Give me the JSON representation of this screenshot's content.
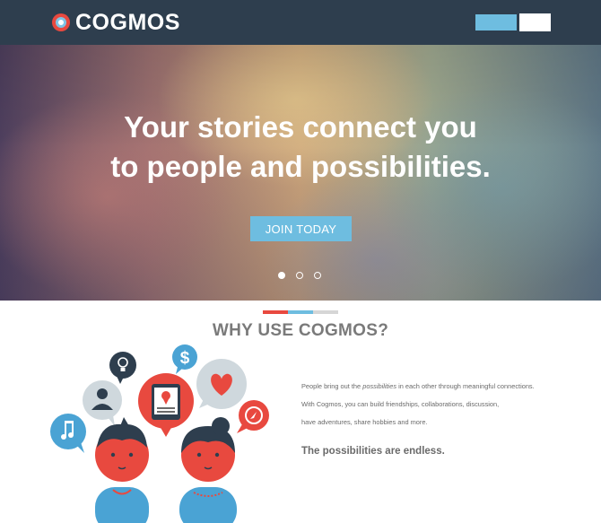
{
  "header": {
    "brand": "COGMOS",
    "colors": {
      "bar": "#2e3e4e",
      "accent": "#6ebde0",
      "logo_red": "#e8493f"
    }
  },
  "hero": {
    "headline_line1": "Your stories connect  you",
    "headline_line2": "to people and possibilities.",
    "cta_label": "JOIN TODAY",
    "slides": 3,
    "active_slide": 1
  },
  "why": {
    "title": "WHY USE COGMOS?",
    "divider_colors": [
      "#e8493f",
      "#6ebde0",
      "#d6d6d6"
    ],
    "line1_before": "People bring out the ",
    "line1_emphasis": "possibilities",
    "line1_after": " in each other through meaningful connections.",
    "line2": "With Cogmos, you can build friendships, collaborations, discussion,",
    "line3": "have adventures, share hobbies and more.",
    "tagline": "The possibilities are endless."
  },
  "illustration": {
    "icons": [
      "lightbulb-icon",
      "dollar-icon",
      "user-icon",
      "map-pin-icon",
      "heart-icon",
      "music-note-icon",
      "compass-icon"
    ]
  }
}
